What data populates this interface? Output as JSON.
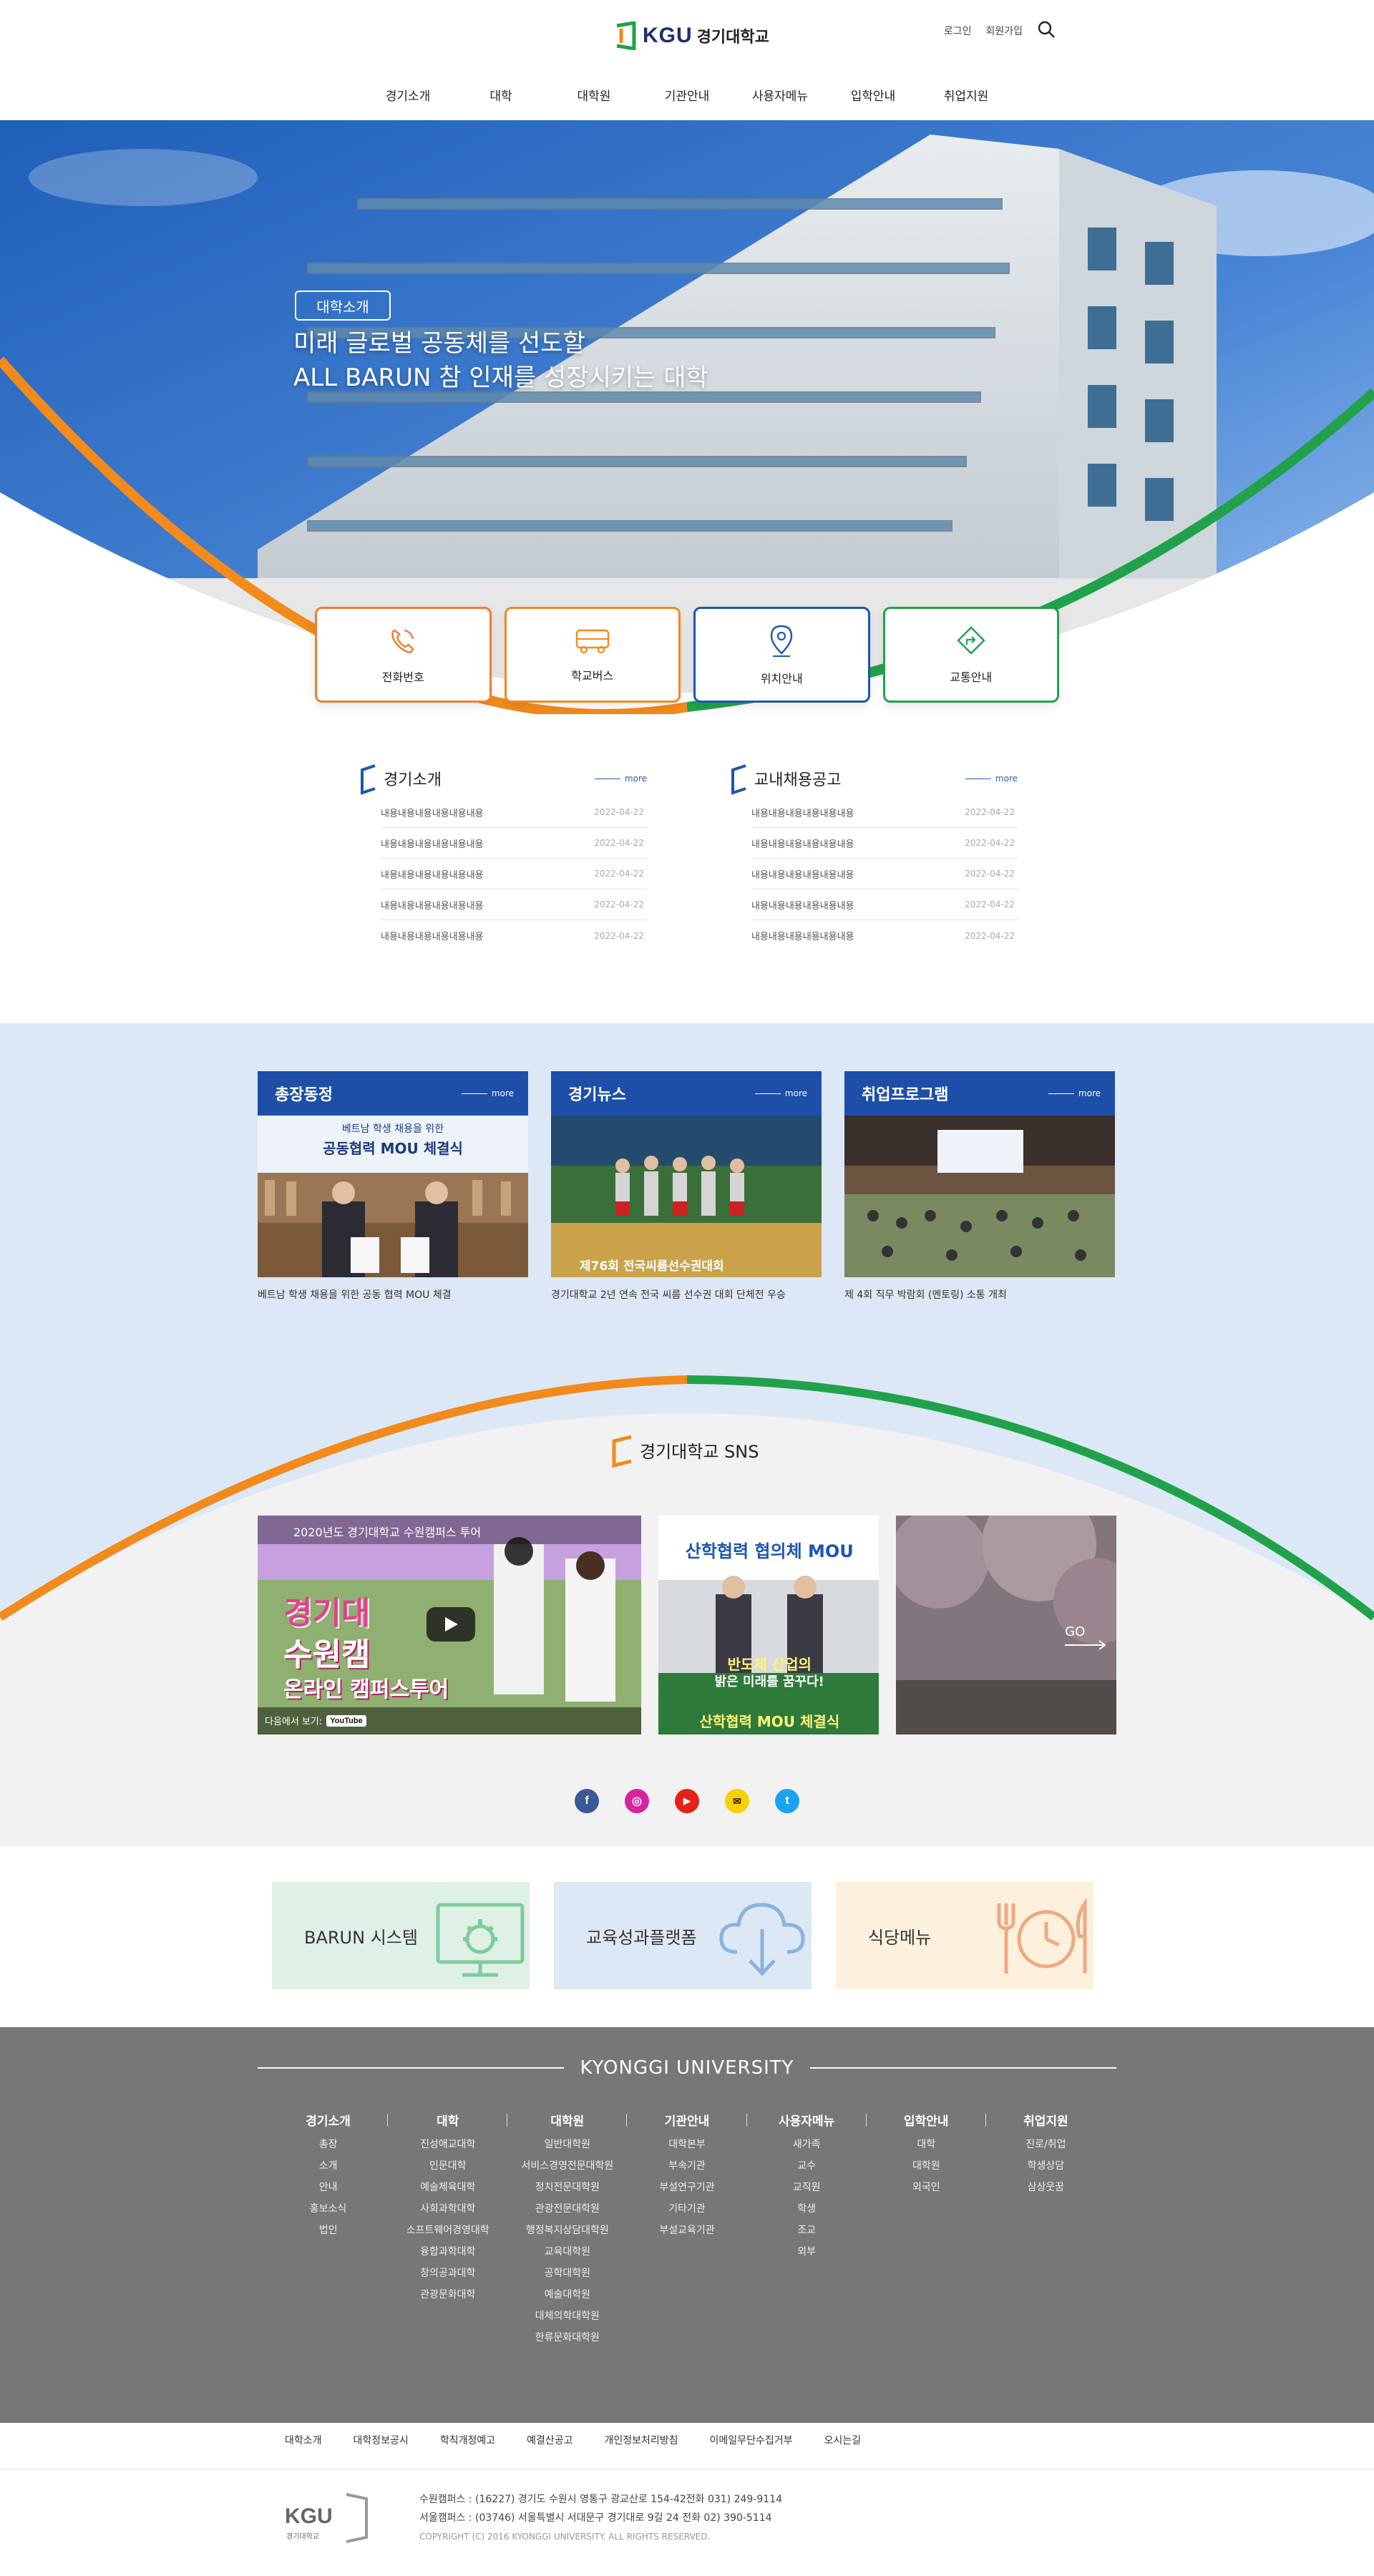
{
  "header": {
    "logo_text": "KGU",
    "logo_name": "경기대학교",
    "util": {
      "login": "로그인",
      "join": "회원가입"
    },
    "nav": [
      "경기소개",
      "대학",
      "대학원",
      "기관안내",
      "사용자메뉴",
      "입학안내",
      "취업지원"
    ]
  },
  "hero": {
    "line1": "미래 글로벌 공동체를 선도할",
    "line2": "ALL BARUN 참 인재를 성장시키는 대학",
    "button": "대학소개"
  },
  "quick": [
    {
      "label": "전화번호",
      "icon": "phone-icon",
      "color": "#f07c32"
    },
    {
      "label": "학교버스",
      "icon": "bus-icon",
      "color": "#f28a1c"
    },
    {
      "label": "위치안내",
      "icon": "location-pin-icon",
      "color": "#1d56b0"
    },
    {
      "label": "교통안내",
      "icon": "directions-icon",
      "color": "#21a24a"
    }
  ],
  "boards": {
    "about": {
      "title": "경기소개",
      "more": "more",
      "items": [
        {
          "text": "내용내용내용내용내용내용",
          "date": "2022-04-22"
        },
        {
          "text": "내용내용내용내용내용내용",
          "date": "2022-04-22"
        },
        {
          "text": "내용내용내용내용내용내용",
          "date": "2022-04-22"
        },
        {
          "text": "내용내용내용내용내용내용",
          "date": "2022-04-22"
        },
        {
          "text": "내용내용내용내용내용내용",
          "date": "2022-04-22"
        }
      ]
    },
    "jobs": {
      "title": "교내채용공고",
      "more": "more",
      "items": [
        {
          "text": "내용내용내용내용내용내용",
          "date": "2022-04-22"
        },
        {
          "text": "내용내용내용내용내용내용",
          "date": "2022-04-22"
        },
        {
          "text": "내용내용내용내용내용내용",
          "date": "2022-04-22"
        },
        {
          "text": "내용내용내용내용내용내용",
          "date": "2022-04-22"
        },
        {
          "text": "내용내용내용내용내용내용",
          "date": "2022-04-22"
        }
      ]
    }
  },
  "news": [
    {
      "title": "총장동정",
      "more": "more",
      "caption": "베트남 학생 채용을 위한 공동 협력 MOU 체결",
      "img_text1": "베트남 학생 채용을 위한",
      "img_text2": "공동협력 MOU 체결식"
    },
    {
      "title": "경기뉴스",
      "more": "more",
      "caption": "경기대학교 2년 연속 전국 씨름 선수권 대회 단체전 우승",
      "img_text1": "제76회 전국씨름선수권대회"
    },
    {
      "title": "취업프로그램",
      "more": "more",
      "caption": "제 4회 직무 박람회 (멘토링) 소통 개최"
    }
  ],
  "sns": {
    "title": "경기대학교 SNS",
    "video_title": "2020년도 경기대학교 수원캠퍼스 투어",
    "video_big1": "경기대",
    "video_big2": "수원캠",
    "video_big3": "온라인 캠퍼스투어",
    "video_watch": "다음에서 보기:",
    "video_yt": "YouTube",
    "mou_top": "산학협력 협의체 MOU",
    "mou_mid1": "반도체 산업의",
    "mou_mid2": "밝은 미래를 꿈꾸다!",
    "mou_bottom": "산학협력 MOU 체결식",
    "go": "GO"
  },
  "social": [
    {
      "name": "facebook-icon",
      "glyph": "f",
      "color": "#3b5998"
    },
    {
      "name": "instagram-icon",
      "glyph": "◎",
      "color": "#d6249f"
    },
    {
      "name": "youtube-icon",
      "glyph": "▶",
      "color": "#e62117"
    },
    {
      "name": "kakaotalk-icon",
      "glyph": "✉",
      "color": "#f5d100"
    },
    {
      "name": "twitter-icon",
      "glyph": "t",
      "color": "#1da1f2"
    }
  ],
  "banners": [
    {
      "label": "BARUN 시스템",
      "bg": "#dff0e6",
      "icon": "monitor-gear-icon"
    },
    {
      "label": "교육성과플랫폼",
      "bg": "#dce8f5",
      "icon": "cloud-download-icon"
    },
    {
      "label": "식당메뉴",
      "bg": "#fdf1dd",
      "icon": "clock-fork-knife-icon"
    }
  ],
  "footer": {
    "title": "KYONGGI UNIVERSITY",
    "sitemap": [
      {
        "head": "경기소개",
        "items": [
          "총장",
          "소개",
          "안내",
          "홍보소식",
          "법인"
        ]
      },
      {
        "head": "대학",
        "items": [
          "진성애교대학",
          "인문대학",
          "예술체육대학",
          "사회과학대학",
          "소프트웨어경영대학",
          "융합과학대학",
          "창의공과대학",
          "관광문화대학"
        ]
      },
      {
        "head": "대학원",
        "items": [
          "일반대학원",
          "서비스경영전문대학원",
          "정치전문대학원",
          "관광전문대학원",
          "행정복지상담대학원",
          "교육대학원",
          "공학대학원",
          "예술대학원",
          "대체의학대학원",
          "한류문화대학원"
        ]
      },
      {
        "head": "기관안내",
        "items": [
          "대학본부",
          "부속기관",
          "부설연구기관",
          "기타기관",
          "부설교육기관"
        ]
      },
      {
        "head": "사용자메뉴",
        "items": [
          "새가족",
          "교수",
          "교직원",
          "학생",
          "조교",
          "외부"
        ]
      },
      {
        "head": "입학안내",
        "items": [
          "대학",
          "대학원",
          "외국인"
        ]
      },
      {
        "head": "취업지원",
        "items": [
          "진로/취업",
          "학생상담",
          "삼상웃꿈"
        ]
      }
    ],
    "links": [
      "대학소개",
      "대학정보공시",
      "학칙개정예고",
      "예결산공고",
      "개인정보처리방침",
      "이메일무단수집거부",
      "오시는길"
    ],
    "addr1": "수원캠퍼스 : (16227) 경기도 수원시 영통구 광교산로 154-42전화 031) 249-9114",
    "addr2": "서울캠퍼스 : (03746) 서울특별시 서대문구 경기대로 9길 24 전화 02) 390-5114",
    "copyright": "COPYRIGHT (C) 2016 KYONGGI UNIVERSITY. ALL RIGHTS RESERVED.",
    "logo_text": "KGU",
    "logo_sub": "경기대학교"
  }
}
